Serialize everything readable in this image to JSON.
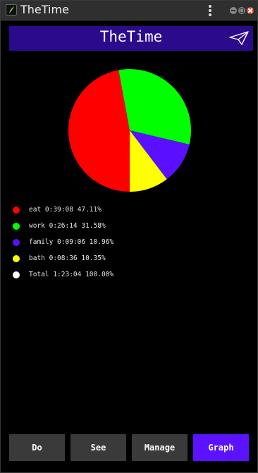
{
  "window": {
    "title": "TheTime"
  },
  "header": {
    "title": "TheTime",
    "icon": "send-icon"
  },
  "chart_data": {
    "type": "pie",
    "slices": [
      {
        "label": "eat",
        "duration": "0:39:08",
        "percent": 47.11,
        "color": "#ff0000"
      },
      {
        "label": "work",
        "duration": "0:26:14",
        "percent": 31.58,
        "color": "#00ff00"
      },
      {
        "label": "family",
        "duration": "0:09:06",
        "percent": 10.96,
        "color": "#5a10ff"
      },
      {
        "label": "bath",
        "duration": "0:08:36",
        "percent": 10.35,
        "color": "#ffff00"
      }
    ],
    "total": {
      "label": "Total",
      "duration": "1:23:04",
      "percent": 100.0,
      "color": "#ffffff"
    }
  },
  "legend": [
    {
      "text": "eat 0:39:08 47.11%",
      "color": "#ff0000"
    },
    {
      "text": "work 0:26:14 31.58%",
      "color": "#00ff00"
    },
    {
      "text": "family 0:09:06 10.96%",
      "color": "#5a10ff"
    },
    {
      "text": "bath 0:08:36 10.35%",
      "color": "#ffff00"
    },
    {
      "text": "Total 1:23:04 100.00%",
      "color": "#ffffff"
    }
  ],
  "nav": [
    {
      "label": "Do",
      "active": false
    },
    {
      "label": "See",
      "active": false
    },
    {
      "label": "Manage",
      "active": false
    },
    {
      "label": "Graph",
      "active": true
    }
  ]
}
